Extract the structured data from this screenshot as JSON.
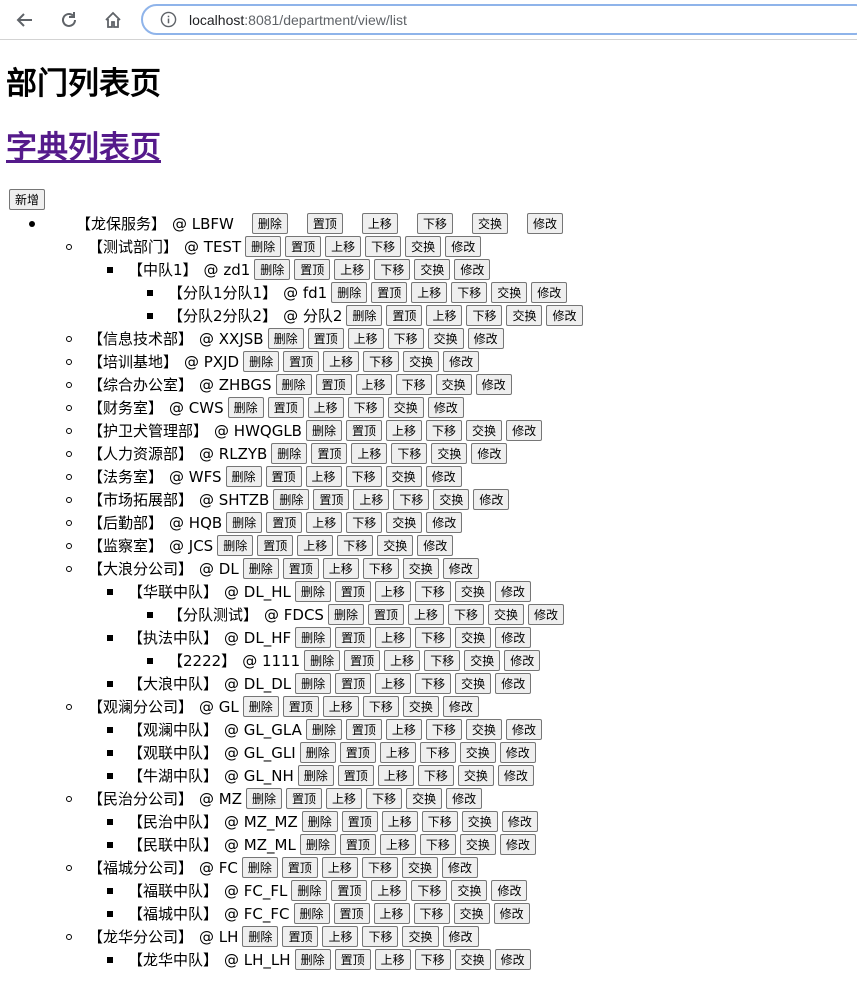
{
  "browser": {
    "url_host": "localhost",
    "url_rest": ":8081/department/view/list"
  },
  "page": {
    "title": "部门列表页",
    "dict_link": "字典列表页",
    "add_button": "新增"
  },
  "actions": [
    "删除",
    "置顶",
    "上移",
    "下移",
    "交换",
    "修改"
  ],
  "tree": [
    {
      "level": 0,
      "name": "【龙保服务】",
      "code": "@ LBFW"
    },
    {
      "level": 1,
      "name": "【测试部门】",
      "code": "@ TEST"
    },
    {
      "level": 2,
      "name": "【中队1】",
      "code": "@ zd1"
    },
    {
      "level": 3,
      "name": "【分队1分队1】",
      "code": "@ fd1"
    },
    {
      "level": 3,
      "name": "【分队2分队2】",
      "code": "@ 分队2"
    },
    {
      "level": 1,
      "name": "【信息技术部】",
      "code": "@ XXJSB"
    },
    {
      "level": 1,
      "name": "【培训基地】",
      "code": "@ PXJD"
    },
    {
      "level": 1,
      "name": "【综合办公室】",
      "code": "@ ZHBGS"
    },
    {
      "level": 1,
      "name": "【财务室】",
      "code": "@ CWS"
    },
    {
      "level": 1,
      "name": "【护卫犬管理部】",
      "code": "@ HWQGLB"
    },
    {
      "level": 1,
      "name": "【人力资源部】",
      "code": "@ RLZYB"
    },
    {
      "level": 1,
      "name": "【法务室】",
      "code": "@ WFS"
    },
    {
      "level": 1,
      "name": "【市场拓展部】",
      "code": "@ SHTZB"
    },
    {
      "level": 1,
      "name": "【后勤部】",
      "code": "@ HQB"
    },
    {
      "level": 1,
      "name": "【监察室】",
      "code": "@ JCS"
    },
    {
      "level": 1,
      "name": "【大浪分公司】",
      "code": "@ DL"
    },
    {
      "level": 2,
      "name": "【华联中队】",
      "code": "@ DL_HL"
    },
    {
      "level": 3,
      "name": "【分队测试】",
      "code": "@ FDCS"
    },
    {
      "level": 2,
      "name": "【执法中队】",
      "code": "@ DL_HF"
    },
    {
      "level": 3,
      "name": "【2222】",
      "code": "@ 1111"
    },
    {
      "level": 2,
      "name": "【大浪中队】",
      "code": "@ DL_DL"
    },
    {
      "level": 1,
      "name": "【观澜分公司】",
      "code": "@ GL"
    },
    {
      "level": 2,
      "name": "【观澜中队】",
      "code": "@ GL_GLA"
    },
    {
      "level": 2,
      "name": "【观联中队】",
      "code": "@ GL_GLI"
    },
    {
      "level": 2,
      "name": "【牛湖中队】",
      "code": "@ GL_NH"
    },
    {
      "level": 1,
      "name": "【民治分公司】",
      "code": "@ MZ"
    },
    {
      "level": 2,
      "name": "【民治中队】",
      "code": "@ MZ_MZ"
    },
    {
      "level": 2,
      "name": "【民联中队】",
      "code": "@ MZ_ML"
    },
    {
      "level": 1,
      "name": "【福城分公司】",
      "code": "@ FC"
    },
    {
      "level": 2,
      "name": "【福联中队】",
      "code": "@ FC_FL"
    },
    {
      "level": 2,
      "name": "【福城中队】",
      "code": "@ FC_FC"
    },
    {
      "level": 1,
      "name": "【龙华分公司】",
      "code": "@ LH"
    },
    {
      "level": 2,
      "name": "【龙华中队】",
      "code": "@ LH_LH"
    }
  ]
}
